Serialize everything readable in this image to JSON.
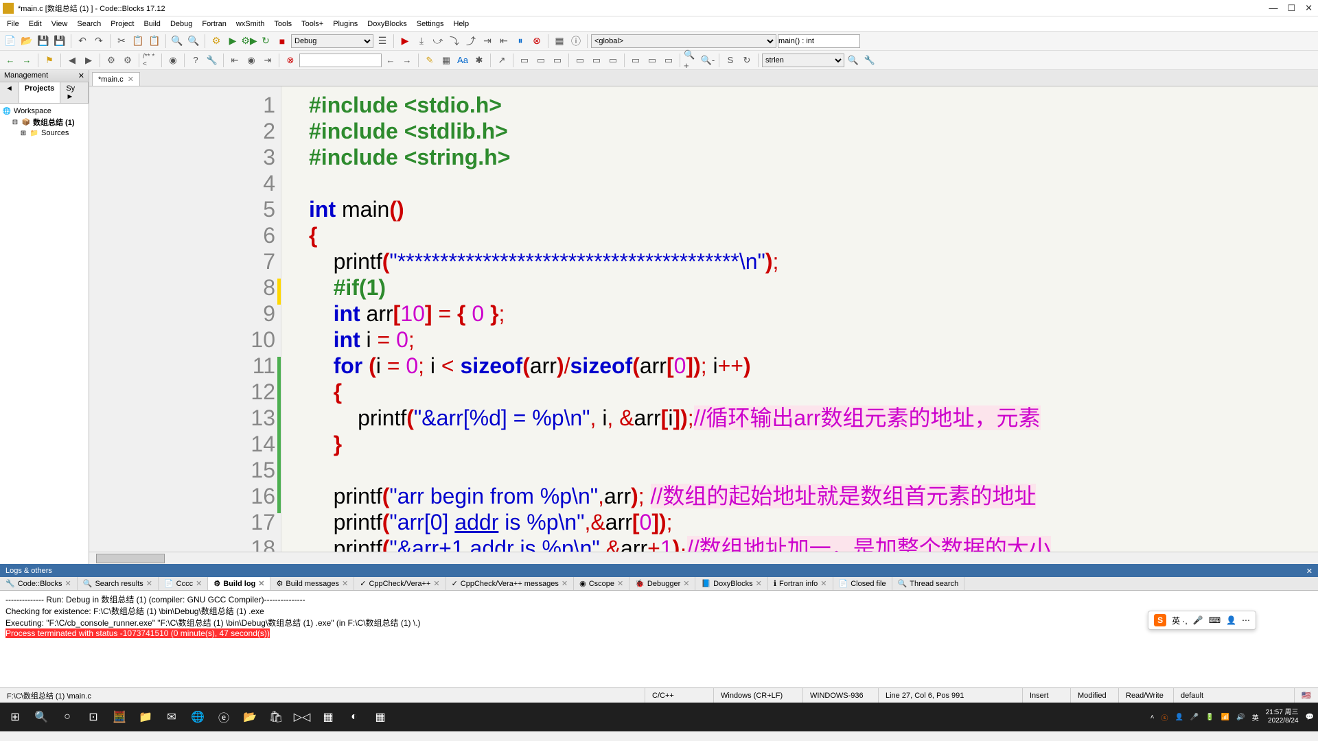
{
  "window": {
    "title": "*main.c [数组总结 (1) ] - Code::Blocks 17.12"
  },
  "menu": [
    "File",
    "Edit",
    "View",
    "Search",
    "Project",
    "Build",
    "Debug",
    "Fortran",
    "wxSmith",
    "Tools",
    "Tools+",
    "Plugins",
    "DoxyBlocks",
    "Settings",
    "Help"
  ],
  "toolbar": {
    "config": "Debug",
    "scope": "<global>",
    "func": "main() : int"
  },
  "toolbar2": {
    "funcselect": "strlen"
  },
  "mgmt": {
    "title": "Management",
    "tabs": [
      "◄",
      "Projects",
      "Sy ►"
    ],
    "tree": {
      "workspace": "Workspace",
      "project": "数组总结 (1)",
      "sources": "Sources"
    }
  },
  "editor": {
    "tab": "*main.c",
    "lines": [
      1,
      2,
      3,
      4,
      5,
      6,
      7,
      8,
      9,
      10,
      11,
      12,
      13,
      14,
      15,
      16,
      17,
      18
    ]
  },
  "logs": {
    "title": "Logs & others",
    "tabs": [
      "Code::Blocks",
      "Search results",
      "Cccc",
      "Build log",
      "Build messages",
      "CppCheck/Vera++",
      "CppCheck/Vera++ messages",
      "Cscope",
      "Debugger",
      "DoxyBlocks",
      "Fortran info",
      "Closed file",
      "Thread search"
    ],
    "active_tab": 3,
    "lines": [
      "-------------- Run: Debug in 数组总结 (1) (compiler: GNU GCC Compiler)---------------",
      "",
      "Checking for existence: F:\\C\\数组总结 (1) \\bin\\Debug\\数组总结 (1) .exe",
      "Executing: \"F:\\C/cb_console_runner.exe\" \"F:\\C\\数组总结 (1) \\bin\\Debug\\数组总结 (1) .exe\"  (in F:\\C\\数组总结 (1) \\.)"
    ],
    "err_line": "Process terminated with status -1073741510 (0 minute(s), 47 second(s))"
  },
  "status": {
    "path": "F:\\C\\数组总结 (1) \\main.c",
    "lang": "C/C++",
    "eol": "Windows (CR+LF)",
    "encoding": "WINDOWS-936",
    "pos": "Line 27, Col 6, Pos 991",
    "insert": "Insert",
    "modified": "Modified",
    "rw": "Read/Write",
    "profile": "default"
  },
  "taskbar": {
    "time": "21:57 周三",
    "date": "2022/8/24",
    "ime_label": "英"
  },
  "ime": {
    "label": "英 ·,"
  }
}
